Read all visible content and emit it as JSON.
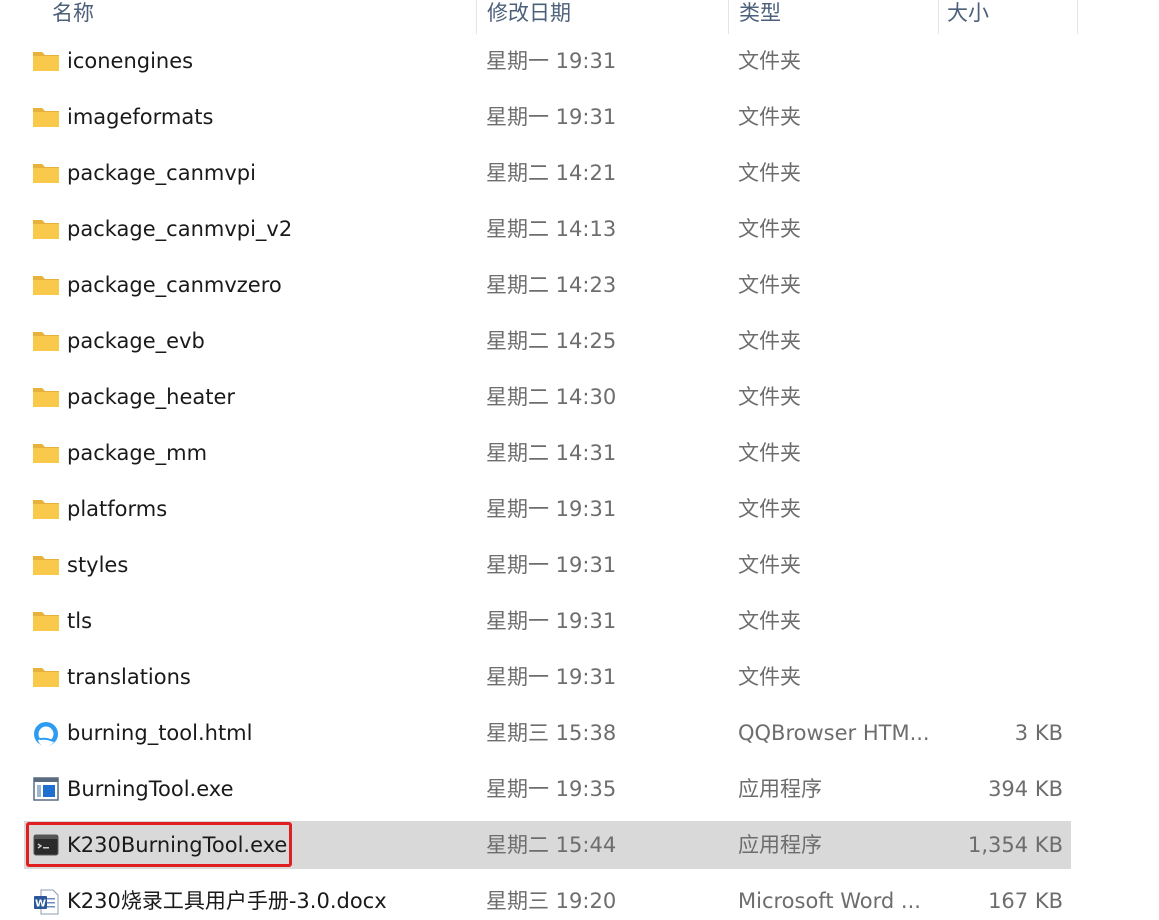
{
  "columns": {
    "name": "名称",
    "date": "修改日期",
    "type": "类型",
    "size": "大小"
  },
  "files": [
    {
      "name": "iconengines",
      "date": "星期一 19:31",
      "type": "文件夹",
      "size": "",
      "icon": "folder-icon"
    },
    {
      "name": "imageformats",
      "date": "星期一 19:31",
      "type": "文件夹",
      "size": "",
      "icon": "folder-icon"
    },
    {
      "name": "package_canmvpi",
      "date": "星期二 14:21",
      "type": "文件夹",
      "size": "",
      "icon": "folder-icon"
    },
    {
      "name": "package_canmvpi_v2",
      "date": "星期二 14:13",
      "type": "文件夹",
      "size": "",
      "icon": "folder-icon"
    },
    {
      "name": "package_canmvzero",
      "date": "星期二 14:23",
      "type": "文件夹",
      "size": "",
      "icon": "folder-icon"
    },
    {
      "name": "package_evb",
      "date": "星期二 14:25",
      "type": "文件夹",
      "size": "",
      "icon": "folder-icon"
    },
    {
      "name": "package_heater",
      "date": "星期二 14:30",
      "type": "文件夹",
      "size": "",
      "icon": "folder-icon"
    },
    {
      "name": "package_mm",
      "date": "星期二 14:31",
      "type": "文件夹",
      "size": "",
      "icon": "folder-icon"
    },
    {
      "name": "platforms",
      "date": "星期一 19:31",
      "type": "文件夹",
      "size": "",
      "icon": "folder-icon"
    },
    {
      "name": "styles",
      "date": "星期一 19:31",
      "type": "文件夹",
      "size": "",
      "icon": "folder-icon"
    },
    {
      "name": "tls",
      "date": "星期一 19:31",
      "type": "文件夹",
      "size": "",
      "icon": "folder-icon"
    },
    {
      "name": "translations",
      "date": "星期一 19:31",
      "type": "文件夹",
      "size": "",
      "icon": "folder-icon"
    },
    {
      "name": "burning_tool.html",
      "date": "星期三 15:38",
      "type": "QQBrowser HTM...",
      "size": "3 KB",
      "icon": "qqbrowser-html-icon"
    },
    {
      "name": "BurningTool.exe",
      "date": "星期一 19:35",
      "type": "应用程序",
      "size": "394 KB",
      "icon": "application-icon"
    },
    {
      "name": "K230BurningTool.exe",
      "date": "星期二 15:44",
      "type": "应用程序",
      "size": "1,354 KB",
      "icon": "console-app-icon",
      "selected": true
    },
    {
      "name": "K230烧录工具用户手册-3.0.docx",
      "date": "星期三 19:20",
      "type": "Microsoft Word ...",
      "size": "167 KB",
      "icon": "word-document-icon"
    }
  ],
  "colors": {
    "selection": "#d9d9d9",
    "highlight_border": "#e02020",
    "folder": "#f8c94a",
    "header_text": "#4c607a"
  }
}
